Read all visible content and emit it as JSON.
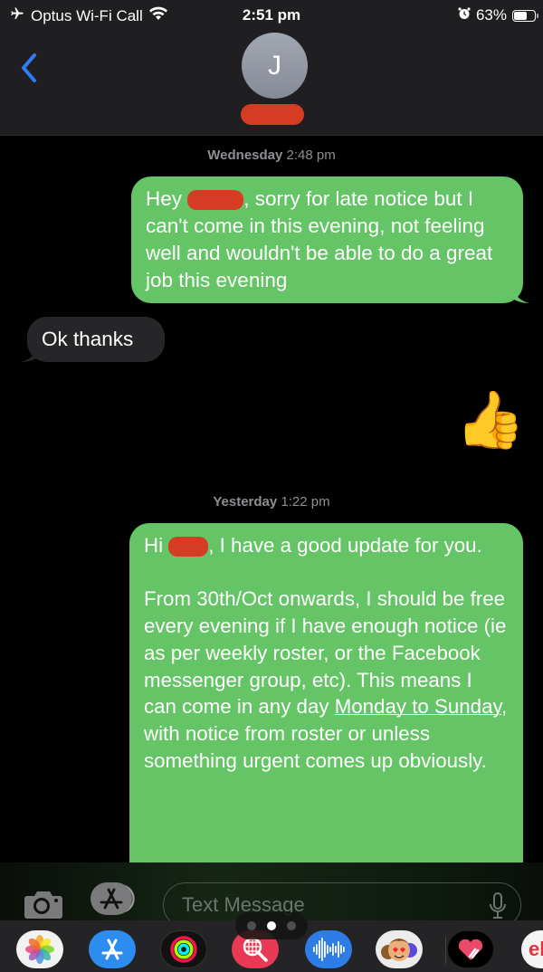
{
  "status_bar": {
    "carrier": "Optus Wi-Fi Call",
    "time": "2:51 pm",
    "battery_percent_label": "63%",
    "battery_level": 0.63,
    "icons": [
      "airplane-icon",
      "wifi-icon",
      "alarm-icon",
      "battery-icon"
    ]
  },
  "header": {
    "contact_initial": "J",
    "back_icon": "chevron-left-icon"
  },
  "conversation": [
    {
      "type": "timestamp",
      "day": "Wednesday",
      "time": "2:48 pm"
    },
    {
      "type": "message",
      "direction": "sent",
      "text_before_redaction": "Hey",
      "text_after_redaction": ", sorry for late notice but I can't come in this evening, not feeling well and wouldn't be able to do a great job this evening"
    },
    {
      "type": "message",
      "direction": "received",
      "text": "Ok thanks"
    },
    {
      "type": "emoji",
      "direction": "sent",
      "text": "👍"
    },
    {
      "type": "timestamp",
      "day": "Yesterday",
      "time": "1:22 pm"
    },
    {
      "type": "message",
      "direction": "sent",
      "text_before_redaction": "Hi",
      "text_after_redaction": ", I have a good update for you.",
      "paragraph2_part1": "From 30th/Oct onwards, I should be free every evening if I have enough notice (ie as per weekly roster, or the Facebook messenger group, etc). This means I can come in any day ",
      "paragraph2_underlined": "Monday to Sunday",
      "paragraph2_part2": ", with notice from roster or unless something urgent comes up obviously."
    }
  ],
  "input_bar": {
    "placeholder": "Text Message",
    "camera_icon": "camera-icon",
    "apps_icon": "app-store-icon",
    "mic_icon": "microphone-icon"
  },
  "app_drawer": {
    "page_count": 3,
    "active_page": 2,
    "apps": [
      {
        "name": "Photos",
        "icon": "photos-icon"
      },
      {
        "name": "App Store",
        "icon": "app-store-icon"
      },
      {
        "name": "Activity",
        "icon": "activity-rings-icon"
      },
      {
        "name": "Search Images",
        "icon": "globe-search-icon"
      },
      {
        "name": "Audio",
        "icon": "audio-waveform-icon"
      },
      {
        "name": "Memoji Stickers",
        "icon": "memoji-icon"
      },
      {
        "name": "Digital Touch",
        "icon": "heart-touch-icon"
      },
      {
        "name": "eBay",
        "icon": "ebay-icon",
        "label": "el"
      }
    ]
  },
  "colors": {
    "sent_bubble": "#65c466",
    "received_bubble": "#262629",
    "accent_blue": "#2f7cf6",
    "redaction": "#d63b23"
  }
}
